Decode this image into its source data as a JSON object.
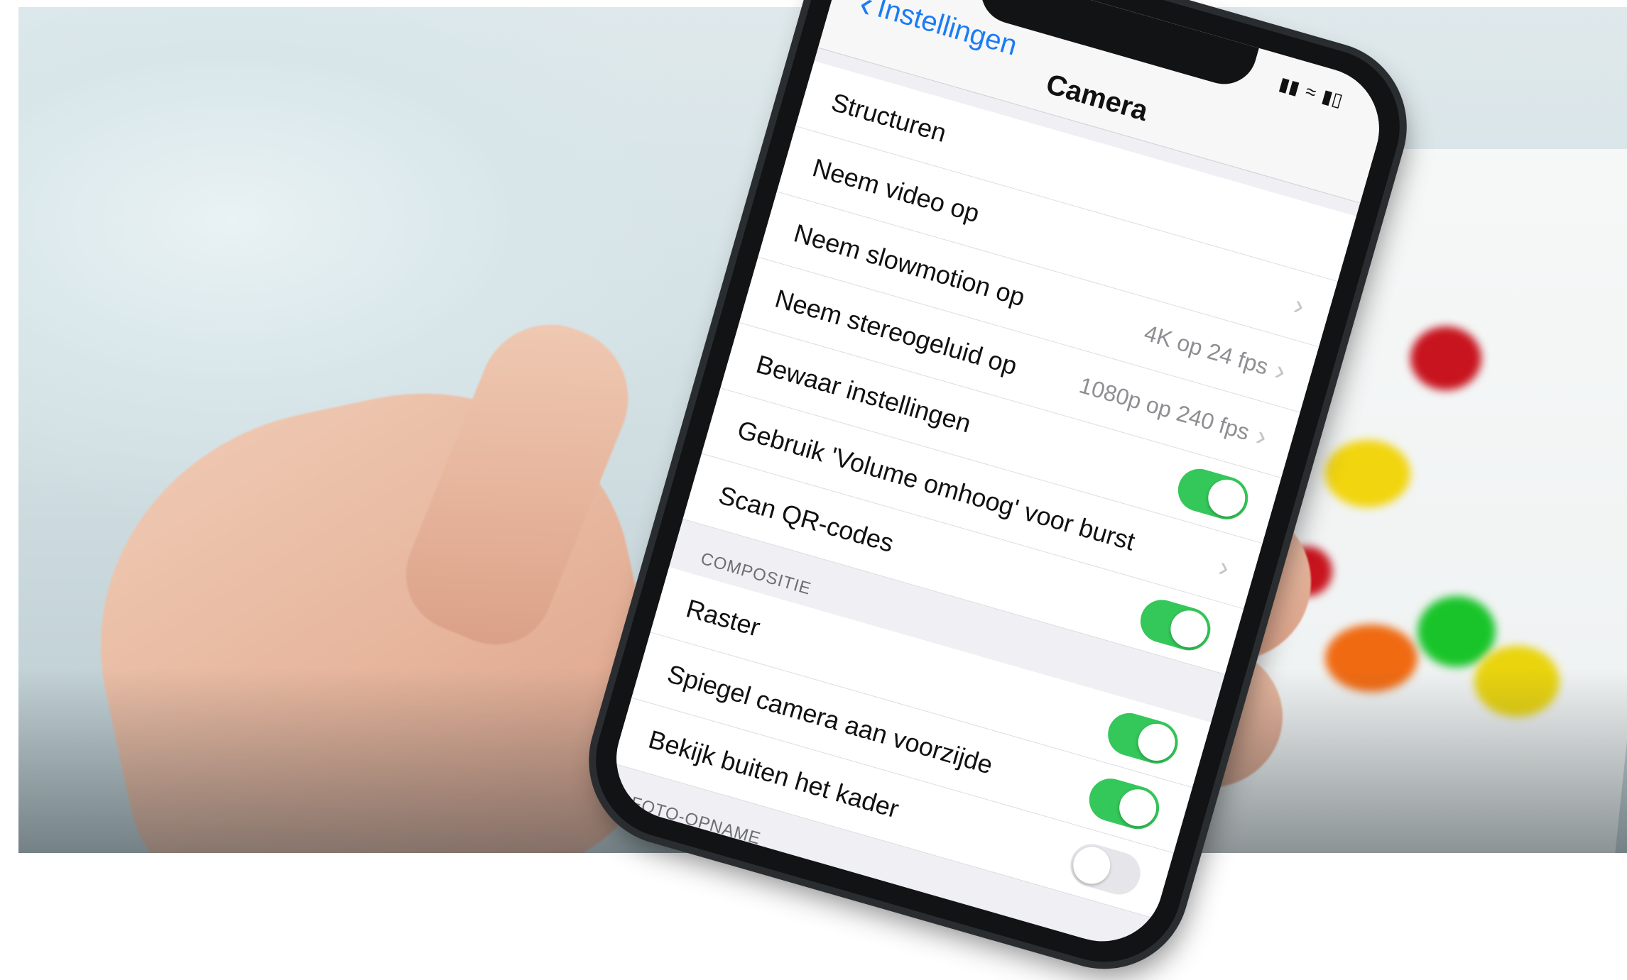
{
  "colors": {
    "accent": "#1a7cf6",
    "toggle_on": "#34c759",
    "toggle_off": "#e5e5ea"
  },
  "status_icons": [
    "signal-icon",
    "wifi-icon",
    "battery-icon"
  ],
  "nav": {
    "back_label": "Instellingen",
    "title": "Camera"
  },
  "rows_group1": [
    {
      "label": "Structuren",
      "value": "",
      "control": "none"
    },
    {
      "label": "Neem video op",
      "value": "",
      "control": "chevron"
    },
    {
      "label": "Neem slowmotion op",
      "value": "4K op 24 fps",
      "control": "chevron"
    },
    {
      "label": "Neem stereogeluid op",
      "value": "1080p op 240 fps",
      "control": "chevron"
    },
    {
      "label": "Bewaar instellingen",
      "value": "",
      "control": "toggle-on"
    },
    {
      "label": "Gebruik 'Volume omhoog' voor burst",
      "value": "",
      "control": "chevron"
    },
    {
      "label": "Scan QR-codes",
      "value": "",
      "control": "toggle-on"
    }
  ],
  "section_composition": "COMPOSITIE",
  "rows_group2": [
    {
      "label": "Raster",
      "value": "",
      "control": "toggle-on"
    },
    {
      "label": "Spiegel camera aan voorzijde",
      "value": "",
      "control": "toggle-on"
    },
    {
      "label": "Bekijk buiten het kader",
      "value": "",
      "control": "toggle-off"
    }
  ],
  "section_photo": "FOTO-OPNAME"
}
